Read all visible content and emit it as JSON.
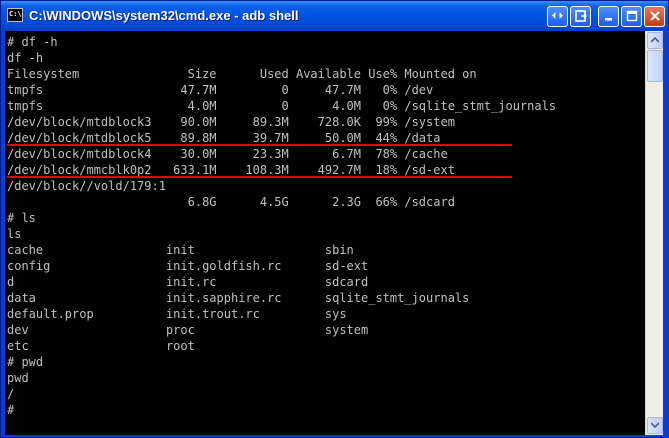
{
  "window": {
    "title": "C:\\WINDOWS\\system32\\cmd.exe - adb shell",
    "icon_text": "C:\\",
    "buttons": [
      "restore-down",
      "minimize",
      "maximize",
      "close"
    ]
  },
  "console_lines": [
    "# df -h",
    "df -h",
    "Filesystem               Size      Used Available Use% Mounted on",
    "tmpfs                   47.7M         0     47.7M   0% /dev",
    "tmpfs                    4.0M         0      4.0M   0% /sqlite_stmt_journals",
    "/dev/block/mtdblock3    90.0M     89.3M    728.0K  99% /system",
    "/dev/block/mtdblock5    89.8M     39.7M     50.0M  44% /data",
    "/dev/block/mtdblock4    30.0M     23.3M      6.7M  78% /cache",
    "/dev/block/mmcblk0p2   633.1M    108.3M    492.7M  18% /sd-ext",
    "/dev/block//vold/179:1",
    "                         6.8G      4.5G      2.3G  66% /sdcard",
    "# ls",
    "ls",
    "cache                 init                  sbin",
    "config                init.goldfish.rc      sd-ext",
    "d                     init.rc               sdcard",
    "data                  init.sapphire.rc      sqlite_stmt_journals",
    "default.prop          init.trout.rc         sys",
    "dev                   proc                  system",
    "etc                   root",
    "# pwd",
    "pwd",
    "/",
    "#"
  ],
  "highlight_color": "#e00000",
  "console_colors": {
    "background": "#000000",
    "foreground": "#c0c0c0"
  }
}
